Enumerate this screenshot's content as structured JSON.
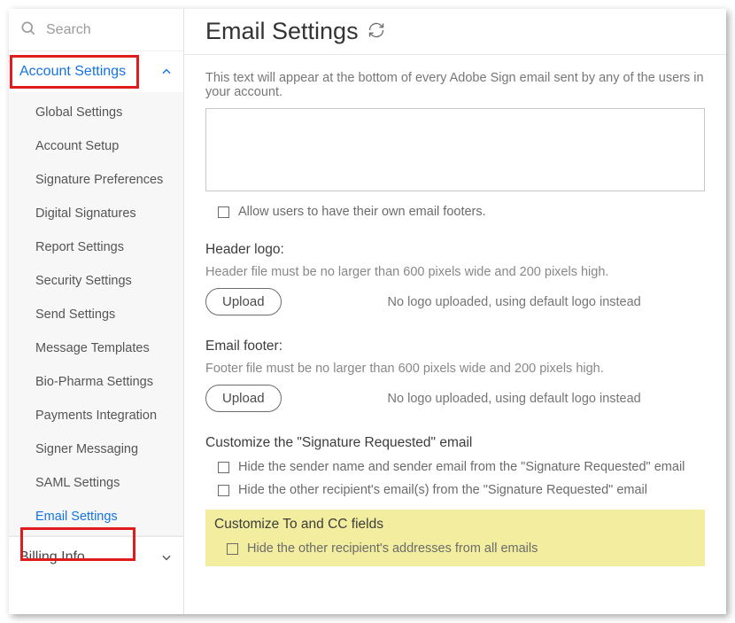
{
  "search_placeholder": "Search",
  "sections": {
    "account_settings_label": "Account Settings",
    "billing_info_label": "Billing Info"
  },
  "submenu": [
    "Global Settings",
    "Account Setup",
    "Signature Preferences",
    "Digital Signatures",
    "Report Settings",
    "Security Settings",
    "Send Settings",
    "Message Templates",
    "Bio-Pharma Settings",
    "Payments Integration",
    "Signer Messaging",
    "SAML Settings",
    "Email Settings"
  ],
  "page_title": "Email Settings",
  "footer_intro": "This text will appear at the bottom of every Adobe Sign email sent by any of the users in your account.",
  "allow_own_footers": "Allow users to have their own email footers.",
  "header_logo": {
    "title": "Header logo:",
    "help": "Header file must be no larger than 600 pixels wide and 200 pixels high.",
    "upload": "Upload",
    "status": "No logo uploaded, using default logo instead"
  },
  "email_footer": {
    "title": "Email footer:",
    "help": "Footer file must be no larger than 600 pixels wide and 200 pixels high.",
    "upload": "Upload",
    "status": "No logo uploaded, using default logo instead"
  },
  "sig_req": {
    "title": "Customize the \"Signature Requested\" email",
    "opt1": "Hide the sender name and sender email from the \"Signature Requested\" email",
    "opt2": "Hide the other recipient's email(s) from the \"Signature Requested\" email"
  },
  "to_cc": {
    "title": "Customize To and CC fields",
    "opt1": "Hide the other recipient's addresses from all emails"
  }
}
